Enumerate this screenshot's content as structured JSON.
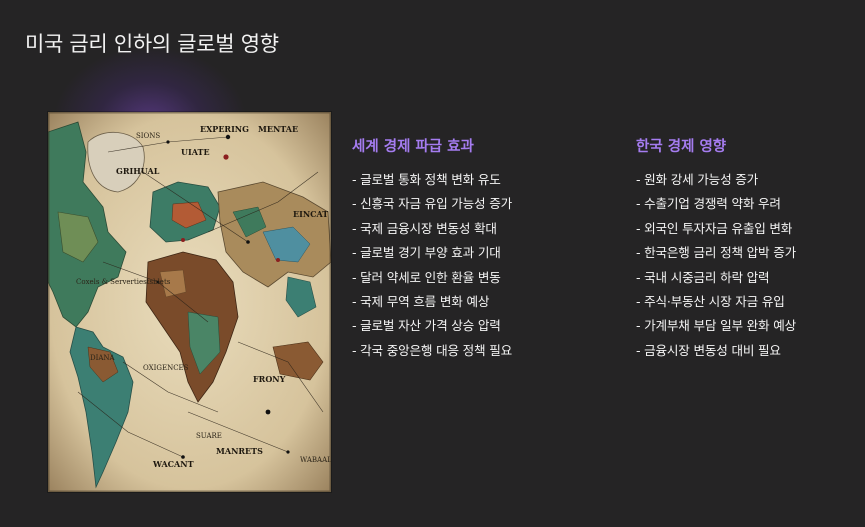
{
  "slide": {
    "title": "미국 금리 인하의 글로벌 영향",
    "accent_color": "#a57cf0",
    "background_color": "#252425"
  },
  "image": {
    "description_icon": "vintage-world-map-image",
    "labels": [
      "EXPERING",
      "MENTAE",
      "SIONS",
      "UIATE",
      "GRIHUAL",
      "EINCAT",
      "Coxels & Servertiestsblets",
      "DIANA",
      "OXIGENCES",
      "FRONY",
      "SUARE",
      "MANRETS",
      "WACANT",
      "WABAALE PROCESS DANOS"
    ]
  },
  "left_column": {
    "heading": "세계 경제 파급 효과",
    "items": [
      "- 글로벌 통화 정책 변화 유도",
      "- 신흥국 자금 유입 가능성 증가",
      "- 국제 금융시장 변동성 확대",
      "- 글로벌 경기 부양 효과 기대",
      "- 달러 약세로 인한 환율 변동",
      "- 국제 무역 흐름 변화 예상",
      "- 글로벌 자산 가격 상승 압력",
      "- 각국 중앙은행 대응 정책 필요"
    ]
  },
  "right_column": {
    "heading": "한국 경제 영향",
    "items": [
      "- 원화 강세 가능성 증가",
      "- 수출기업 경쟁력 약화 우려",
      "- 외국인 투자자금 유출입 변화",
      "- 한국은행 금리 정책 압박 증가",
      "- 국내 시중금리 하락 압력",
      "- 주식·부동산 시장 자금 유입",
      "- 가계부채 부담 일부 완화 예상",
      "- 금융시장 변동성 대비 필요"
    ]
  }
}
